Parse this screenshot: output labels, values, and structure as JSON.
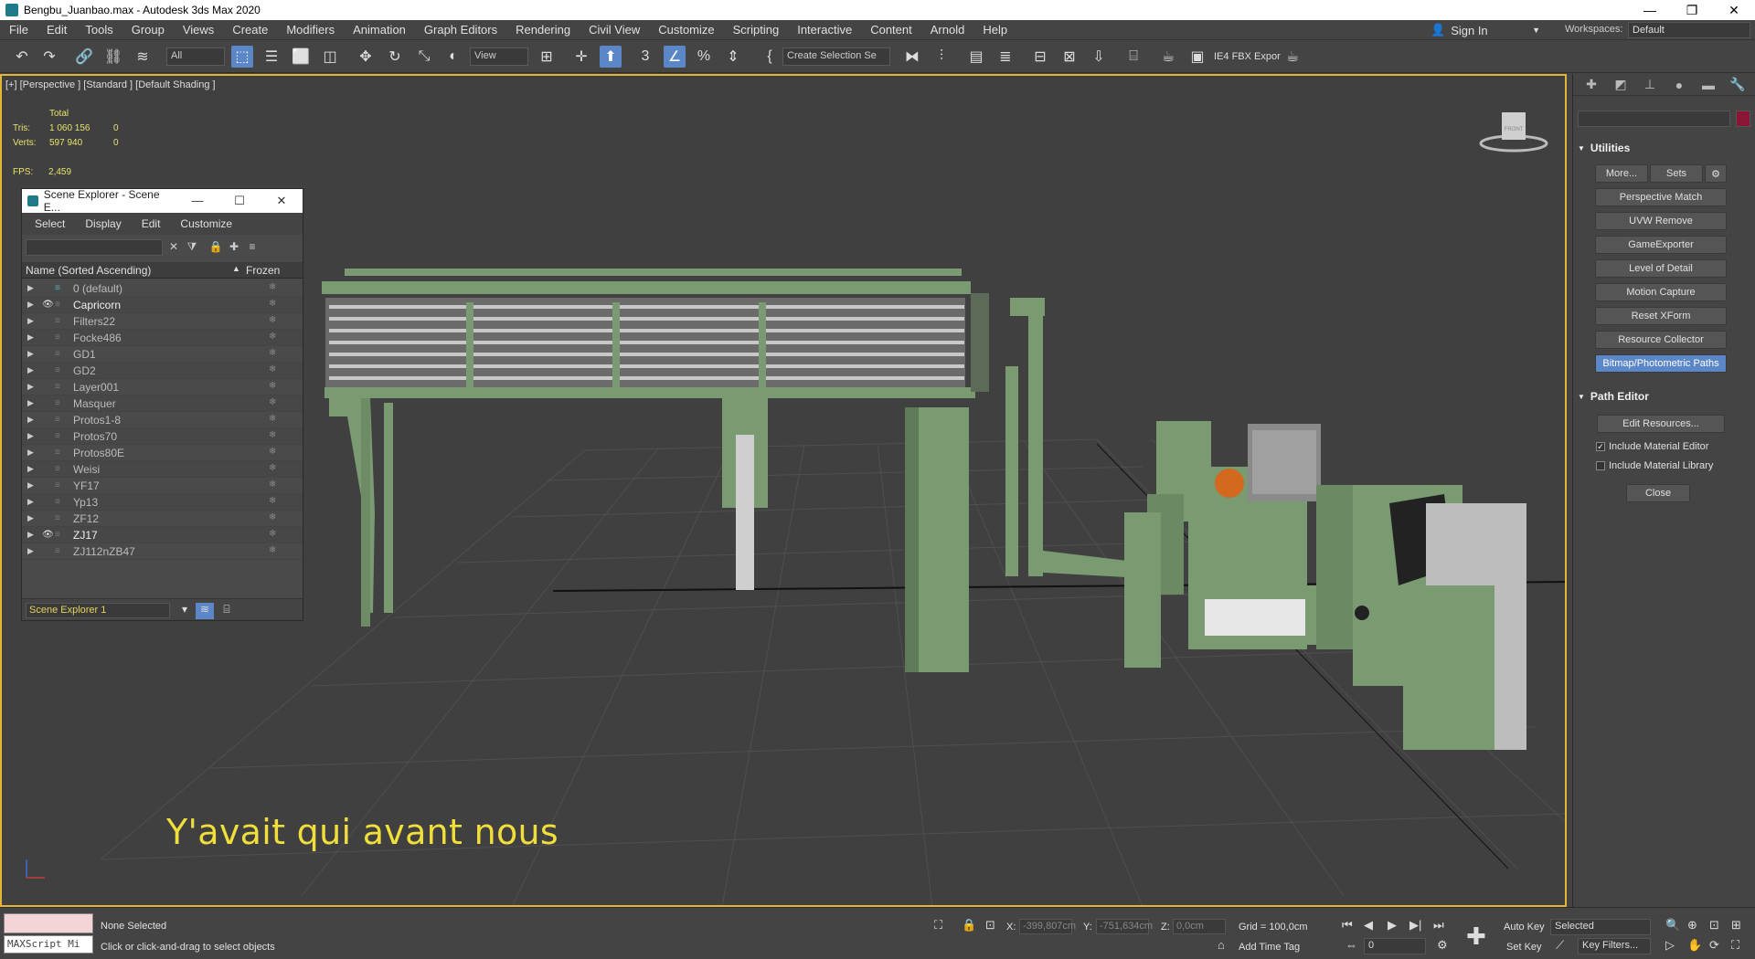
{
  "window": {
    "title": "Bengbu_Juanbao.max - Autodesk 3ds Max 2020",
    "controls": [
      "—",
      "❐",
      "✕"
    ]
  },
  "menu": {
    "items": [
      "File",
      "Edit",
      "Tools",
      "Group",
      "Views",
      "Create",
      "Modifiers",
      "Animation",
      "Graph Editors",
      "Rendering",
      "Civil View",
      "Customize",
      "Scripting",
      "Interactive",
      "Content",
      "Arnold",
      "Help"
    ],
    "sign_in": "Sign In",
    "workspace_label": "Workspaces:",
    "workspace_value": "Default"
  },
  "toolbar": {
    "filter_value": "All",
    "ref_coord_value": "View",
    "selection_set_value": "Create Selection Se",
    "plugin_label": "IE4 FBX Expor",
    "icons": [
      "undo-icon",
      "redo-icon",
      "link-icon",
      "unlink-icon",
      "bind-spacewarp-icon",
      "select-icon",
      "select-by-name-icon",
      "rect-region-icon",
      "window-crossing-icon",
      "move-icon",
      "rotate-icon",
      "scale-icon",
      "placement-icon",
      "pivot-icon",
      "snap-icon",
      "angle-snap-icon",
      "percent-snap-icon",
      "spinner-snap-icon",
      "mirror-icon",
      "align-icon",
      "layer-icon"
    ]
  },
  "viewport": {
    "label": "[+] [Perspective ] [Standard ] [Default Shading ]",
    "stats_header": "Total",
    "tris_label": "Tris:",
    "tris_value": "1 060 156",
    "tris_sel": "0",
    "verts_label": "Verts:",
    "verts_value": "597 940",
    "verts_sel": "0",
    "fps_label": "FPS:",
    "fps_value": "2,459",
    "subtitle": "Y'avait qui avant nous",
    "viewcube_label": "FRONT"
  },
  "scene_explorer": {
    "title": "Scene Explorer - Scene E...",
    "menu": [
      "Select",
      "Display",
      "Edit",
      "Customize"
    ],
    "col_name": "Name (Sorted Ascending)",
    "col_frozen": "Frozen",
    "rows": [
      {
        "name": "0 (default)",
        "visible": false,
        "bright": false
      },
      {
        "name": "Capricorn",
        "visible": true,
        "bright": true
      },
      {
        "name": "Filters22",
        "visible": false,
        "bright": false
      },
      {
        "name": "Focke486",
        "visible": false,
        "bright": false
      },
      {
        "name": "GD1",
        "visible": false,
        "bright": false
      },
      {
        "name": "GD2",
        "visible": false,
        "bright": false
      },
      {
        "name": "Layer001",
        "visible": false,
        "bright": false
      },
      {
        "name": "Masquer",
        "visible": false,
        "bright": false
      },
      {
        "name": "Protos1-8",
        "visible": false,
        "bright": false
      },
      {
        "name": "Protos70",
        "visible": false,
        "bright": false
      },
      {
        "name": "Protos80E",
        "visible": false,
        "bright": false
      },
      {
        "name": "Weisi",
        "visible": false,
        "bright": false
      },
      {
        "name": "YF17",
        "visible": false,
        "bright": false
      },
      {
        "name": "Yp13",
        "visible": false,
        "bright": false
      },
      {
        "name": "ZF12",
        "visible": false,
        "bright": false
      },
      {
        "name": "ZJ17",
        "visible": true,
        "bright": true
      },
      {
        "name": "ZJ112nZB47",
        "visible": false,
        "bright": false
      }
    ],
    "footer_dropdown": "Scene Explorer 1"
  },
  "command_panel": {
    "utilities_title": "Utilities",
    "more_label": "More...",
    "sets_label": "Sets",
    "utilities": [
      "Perspective Match",
      "UVW Remove",
      "GameExporter",
      "Level of Detail",
      "Motion Capture",
      "Reset XForm",
      "Resource Collector",
      "Bitmap/Photometric Paths"
    ],
    "path_editor_title": "Path Editor",
    "edit_resources": "Edit Resources...",
    "include_material_editor": "Include Material Editor",
    "include_material_library": "Include Material Library",
    "close_label": "Close"
  },
  "statusbar": {
    "maxscript_label": "MAXScript Mi",
    "selection_status": "None Selected",
    "prompt": "Click or click-and-drag to select objects",
    "x_label": "X:",
    "x_value": "-399,807cm",
    "y_label": "Y:",
    "y_value": "-751,634cm",
    "z_label": "Z:",
    "z_value": "0,0cm",
    "grid": "Grid = 100,0cm",
    "add_time_tag": "Add Time Tag",
    "frame_value": "0",
    "auto_key": "Auto Key",
    "set_key": "Set Key",
    "selected_value": "Selected",
    "key_filters": "Key Filters..."
  },
  "colors": {
    "machine_green": "#7a9a72",
    "viewport_bg": "#404040",
    "active_border": "#e3b33a",
    "stats_text": "#e8e26c",
    "subtitle_text": "#f0de3a",
    "highlight_blue": "#5b86c7"
  }
}
